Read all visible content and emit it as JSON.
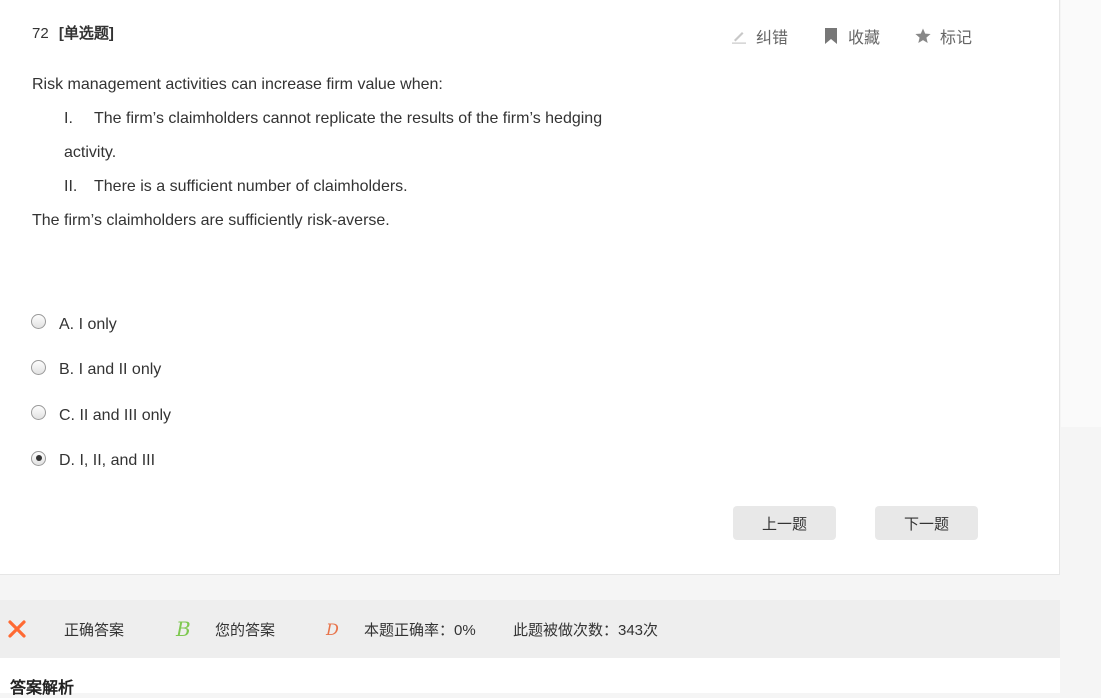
{
  "question": {
    "number": "72",
    "type": "[单选题]",
    "stem": {
      "intro": "Risk management activities can increase firm value when:",
      "item1_numeral": "I.",
      "item1_text": "The firm’s claimholders cannot replicate the results of the firm’s hedging",
      "item1_cont": "activity.",
      "item2_numeral": "II.",
      "item2_text": "There is a sufficient number of claimholders.",
      "item3": "The firm’s claimholders are sufficiently risk-averse."
    },
    "options": [
      {
        "label": "A. I only",
        "selected": false
      },
      {
        "label": "B. I and II only",
        "selected": false
      },
      {
        "label": "C. II and III only",
        "selected": false
      },
      {
        "label": "D. I, II, and III",
        "selected": true
      }
    ]
  },
  "toolbar": {
    "correct_label": "纠错",
    "favorite_label": "收藏",
    "mark_label": "标记"
  },
  "nav": {
    "prev_label": "上一题",
    "next_label": "下一题"
  },
  "result": {
    "correct_answer_label": "正确答案",
    "correct_answer": "B",
    "your_answer_label": "您的答案",
    "your_answer": "D",
    "accuracy_text": "本题正确率：0%",
    "attempts_text": "此题被做次数：343次"
  },
  "analysis": {
    "title": "答案解析"
  },
  "colors": {
    "correct": "#7ec850",
    "wrong": "#e8734a",
    "x_mark": "#ff6a33"
  },
  "icons": [
    "pencil-icon",
    "bookmark-icon",
    "star-icon",
    "close-x-icon"
  ]
}
